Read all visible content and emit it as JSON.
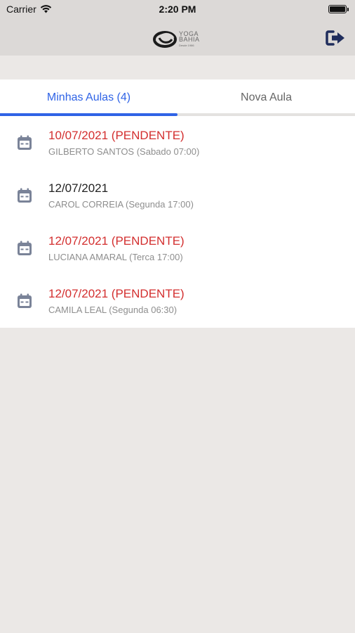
{
  "status_bar": {
    "carrier": "Carrier",
    "time": "2:20 PM"
  },
  "header": {
    "logo": {
      "line1": "YOGA",
      "line2": "BAHIA",
      "tagline": "Desde 1986"
    },
    "exit_icon": "sign-out-icon"
  },
  "tabs": [
    {
      "label": "Minhas Aulas (4)",
      "active": true
    },
    {
      "label": "Nova Aula",
      "active": false
    }
  ],
  "classes": [
    {
      "date": "10/07/2021 (PENDENTE)",
      "details": "GILBERTO SANTOS (Sabado 07:00)",
      "pending": true
    },
    {
      "date": "12/07/2021",
      "details": "CAROL CORREIA (Segunda 17:00)",
      "pending": false
    },
    {
      "date": "12/07/2021 (PENDENTE)",
      "details": "LUCIANA AMARAL (Terca 17:00)",
      "pending": true
    },
    {
      "date": "12/07/2021 (PENDENTE)",
      "details": "CAMILA LEAL (Segunda 06:30)",
      "pending": true
    }
  ],
  "colors": {
    "accent": "#2f63e6",
    "pending": "#d32f2f",
    "icon": "#7a8398",
    "exit_icon": "#1f2d5c"
  }
}
